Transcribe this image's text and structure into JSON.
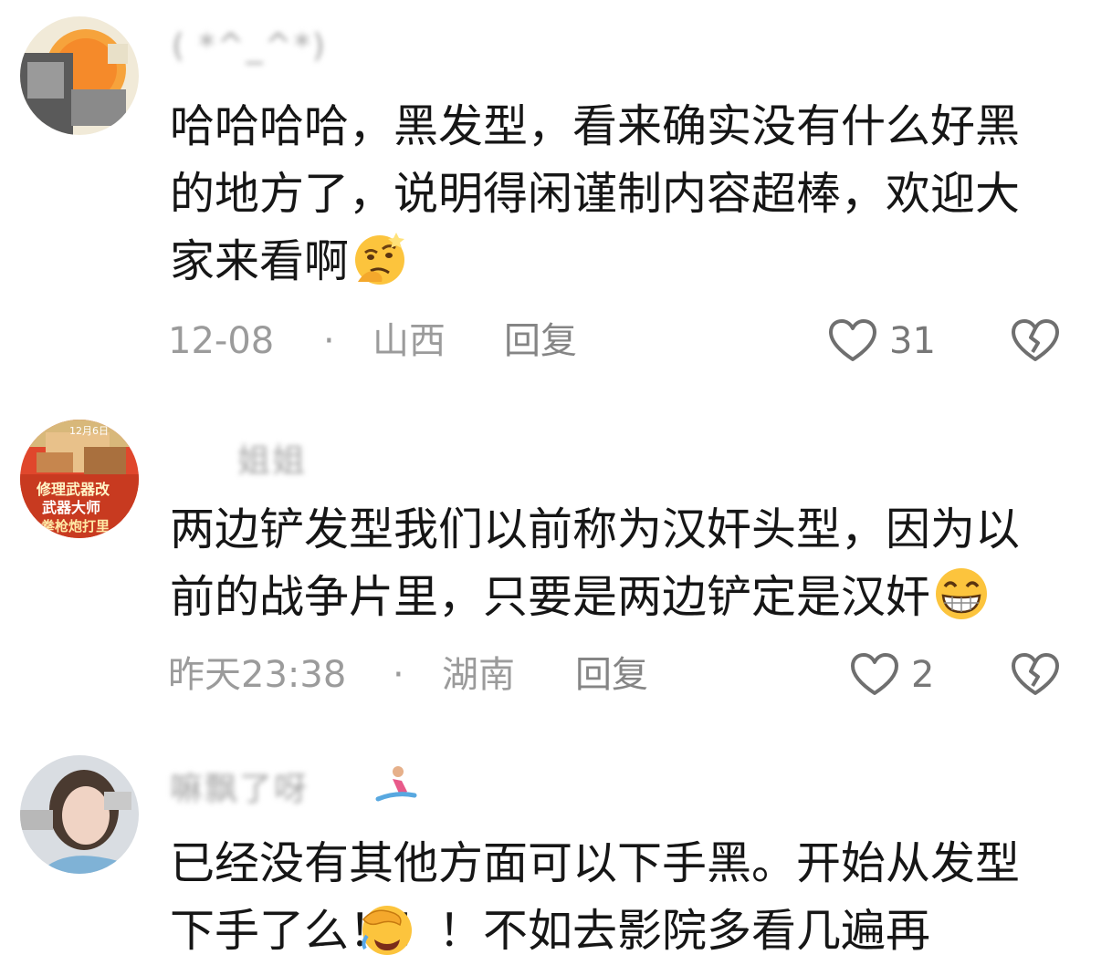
{
  "comments": [
    {
      "username": "( *^_^*)",
      "text_lines": [
        "哈哈哈哈，黑发型，看来确实没有什么好黑",
        "的地方了，说明得闲谨制内容超棒，欢迎大",
        "家来看啊"
      ],
      "emoji_icon": "smirking-thinking-face-icon",
      "date": "12-08",
      "separator": "·",
      "location": "山西",
      "reply_label": "回复",
      "like_count": "31"
    },
    {
      "username": "姐姐",
      "avatar_text_lines": [
        "12月6日",
        "修理武器改",
        "武器大师",
        "一拳枪炮打里"
      ],
      "text_lines": [
        "两边铲发型我们以前称为汉奸头型，因为以",
        "前的战争片里，只要是两边铲定是汉奸"
      ],
      "emoji_icon": "grinning-teeth-face-icon",
      "date": "昨天23:38",
      "separator": "·",
      "location": "湖南",
      "reply_label": "回复",
      "like_count": "2"
    },
    {
      "username": "嘛飘了呀",
      "username_emoji": "snowboarder-icon",
      "text_lines": [
        "已经没有其他方面可以下手黑。开始从发型",
        "下手了么！！！不如去影院多看几遍再"
      ],
      "emoji_icon": "facepalm-face-icon",
      "partial": true
    }
  ],
  "colors": {
    "text": "#161616",
    "meta": "#9b9b9b",
    "icon": "#6f6f6f"
  }
}
